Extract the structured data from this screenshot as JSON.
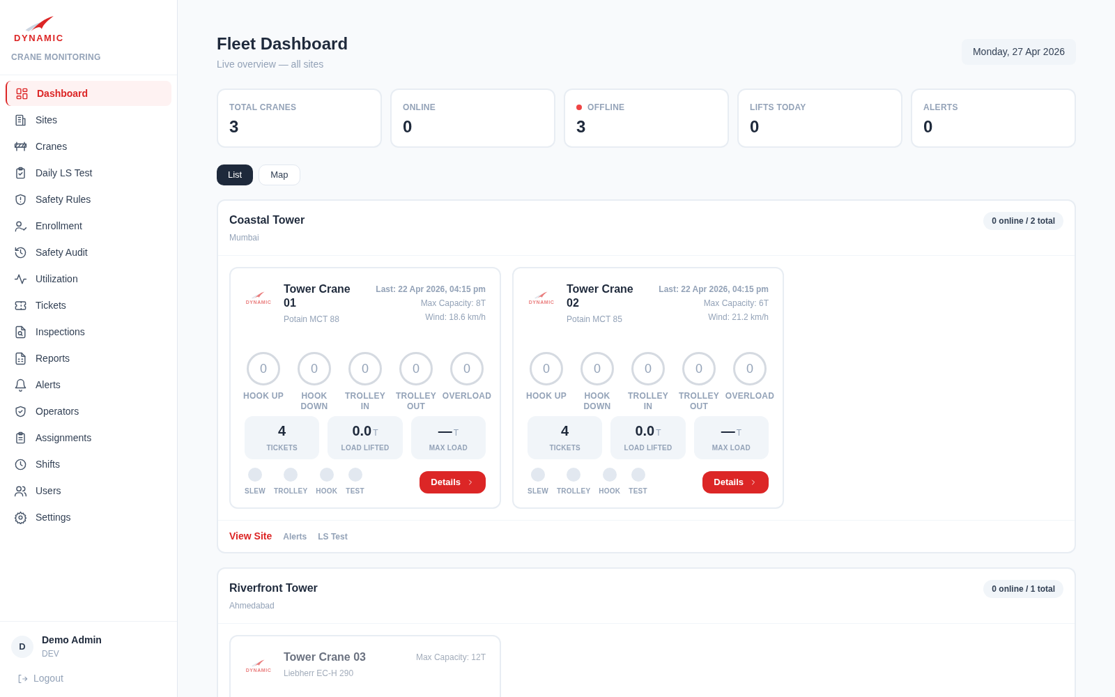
{
  "brand": {
    "logo_text": "DYNAMIC",
    "subtitle": "CRANE MONITORING"
  },
  "nav": [
    {
      "label": "Dashboard",
      "selected": true
    },
    {
      "label": "Sites",
      "selected": false
    },
    {
      "label": "Cranes",
      "selected": false
    },
    {
      "label": "Daily LS Test",
      "selected": false
    },
    {
      "label": "Safety Rules",
      "selected": false
    },
    {
      "label": "Enrollment",
      "selected": false
    },
    {
      "label": "Safety Audit",
      "selected": false
    },
    {
      "label": "Utilization",
      "selected": false
    },
    {
      "label": "Tickets",
      "selected": false
    },
    {
      "label": "Inspections",
      "selected": false
    },
    {
      "label": "Reports",
      "selected": false
    },
    {
      "label": "Alerts",
      "selected": false
    },
    {
      "label": "Operators",
      "selected": false
    },
    {
      "label": "Assignments",
      "selected": false
    },
    {
      "label": "Shifts",
      "selected": false
    },
    {
      "label": "Users",
      "selected": false
    },
    {
      "label": "Settings",
      "selected": false
    }
  ],
  "user": {
    "initial": "D",
    "name": "Demo Admin",
    "role": "DEV",
    "logout": "Logout"
  },
  "header": {
    "title": "Fleet Dashboard",
    "subtitle": "Live overview — all sites",
    "date": "Monday, 27 Apr 2026"
  },
  "stats": [
    {
      "label": "TOTAL CRANES",
      "value": "3",
      "alert_dot": false
    },
    {
      "label": "ONLINE",
      "value": "0",
      "alert_dot": false
    },
    {
      "label": "OFFLINE",
      "value": "3",
      "alert_dot": true
    },
    {
      "label": "LIFTS TODAY",
      "value": "0",
      "alert_dot": false
    },
    {
      "label": "ALERTS",
      "value": "0",
      "alert_dot": false
    }
  ],
  "view_tabs": [
    {
      "label": "List",
      "selected": true
    },
    {
      "label": "Map",
      "selected": false
    }
  ],
  "sites": [
    {
      "name": "Coastal Tower",
      "city": "Mumbai",
      "badge": "0 online / 2 total",
      "cranes": [
        {
          "name": "Tower Crane 01",
          "model": "Potain MCT 88",
          "logo_text": "DYNAMIC",
          "last": "Last: 22 Apr 2026, 04:15 pm",
          "capacity": "Max Capacity: 8T",
          "wind": "Wind: 18.6 km/h",
          "faded": false,
          "counters": [
            {
              "value": "0",
              "label": "HOOK UP"
            },
            {
              "value": "0",
              "label": "HOOK DOWN"
            },
            {
              "value": "0",
              "label": "TROLLEY IN"
            },
            {
              "value": "0",
              "label": "TROLLEY OUT"
            },
            {
              "value": "0",
              "label": "OVERLOAD"
            }
          ],
          "metrics": [
            {
              "value": "4",
              "label": "TICKETS"
            },
            {
              "value": "0.0",
              "unit": "T",
              "label": "LOAD LIFTED"
            },
            {
              "value": "—",
              "unit": "T",
              "label": "MAX LOAD"
            }
          ],
          "indicators": [
            {
              "label": "SLEW",
              "on": false
            },
            {
              "label": "TROLLEY",
              "on": false
            },
            {
              "label": "HOOK",
              "on": false
            },
            {
              "label": "TEST",
              "on": false
            }
          ],
          "button": "Details"
        },
        {
          "name": "Tower Crane 02",
          "model": "Potain MCT 85",
          "logo_text": "DYNAMIC",
          "last": "Last: 22 Apr 2026, 04:15 pm",
          "capacity": "Max Capacity: 6T",
          "wind": "Wind: 21.2 km/h",
          "faded": false,
          "counters": [
            {
              "value": "0",
              "label": "HOOK UP"
            },
            {
              "value": "0",
              "label": "HOOK DOWN"
            },
            {
              "value": "0",
              "label": "TROLLEY IN"
            },
            {
              "value": "0",
              "label": "TROLLEY OUT"
            },
            {
              "value": "0",
              "label": "OVERLOAD"
            }
          ],
          "metrics": [
            {
              "value": "4",
              "label": "TICKETS"
            },
            {
              "value": "0.0",
              "unit": "T",
              "label": "LOAD LIFTED"
            },
            {
              "value": "—",
              "unit": "T",
              "label": "MAX LOAD"
            }
          ],
          "indicators": [
            {
              "label": "SLEW",
              "on": false
            },
            {
              "label": "TROLLEY",
              "on": false
            },
            {
              "label": "HOOK",
              "on": false
            },
            {
              "label": "TEST",
              "on": false
            }
          ],
          "button": "Details"
        }
      ],
      "links": [
        {
          "label": "View Site",
          "primary": true
        },
        {
          "label": "Alerts",
          "primary": false
        },
        {
          "label": "LS Test",
          "primary": false
        }
      ]
    },
    {
      "name": "Riverfront Tower",
      "city": "Ahmedabad",
      "badge": "0 online / 1 total",
      "cranes": [
        {
          "name": "Tower Crane 03",
          "model": "Liebherr EC-H 290",
          "logo_text": "DYNAMIC",
          "capacity": "Max Capacity: 12T",
          "faded": true
        }
      ]
    }
  ]
}
